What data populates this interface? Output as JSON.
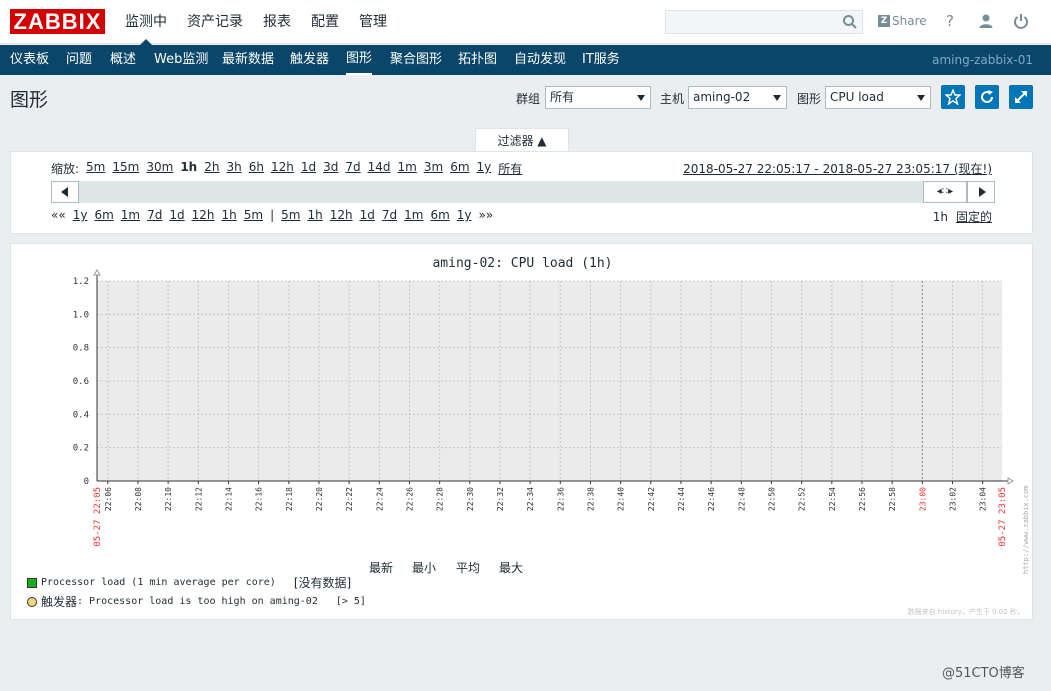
{
  "header": {
    "logo": "ZABBIX",
    "menu": [
      "监测中",
      "资产记录",
      "报表",
      "配置",
      "管理"
    ],
    "share_label": "Share",
    "help_label": "?"
  },
  "nav": {
    "items": [
      "仪表板",
      "问题",
      "概述",
      "Web监测",
      "最新数据",
      "触发器",
      "图形",
      "聚合图形",
      "拓扑图",
      "自动发现",
      "IT服务"
    ],
    "active": "图形",
    "server": "aming-zabbix-01"
  },
  "page": {
    "title": "图形",
    "group_label": "群组",
    "group_value": "所有",
    "host_label": "主机",
    "host_value": "aming-02",
    "graph_label": "图形",
    "graph_value": "CPU load"
  },
  "filter": {
    "tab_label": "过滤器 ▲",
    "zoom_label": "缩放:",
    "zoom_options": [
      "5m",
      "15m",
      "30m",
      "1h",
      "2h",
      "3h",
      "6h",
      "12h",
      "1d",
      "3d",
      "7d",
      "14d",
      "1m",
      "3m",
      "6m",
      "1y",
      "所有"
    ],
    "zoom_current": "1h",
    "period": "2018-05-27 22:05:17 - 2018-05-27 23:05:17 (现在!)",
    "back_links": [
      "1y",
      "6m",
      "1m",
      "7d",
      "1d",
      "12h",
      "1h",
      "5m"
    ],
    "fwd_links": [
      "5m",
      "1h",
      "12h",
      "1d",
      "7d",
      "1m",
      "6m",
      "1y"
    ],
    "period_len": "1h",
    "fixed_label": "固定的"
  },
  "graph": {
    "title": "aming-02: CPU load (1h)",
    "legend_headers": [
      "最新",
      "最小",
      "平均",
      "最大"
    ],
    "legend": [
      {
        "name": "Processor load (1 min average per core)",
        "status": "[没有数据]",
        "color": "#1aaf1a"
      },
      {
        "prefix": "触发器",
        "name": ": Processor load is too high on aming-02",
        "status": "[> 5]",
        "color": "#f7d57c"
      }
    ],
    "credit": "数据来自 history。产生于 0.02 秒。",
    "side_text": "http://www.zabbix.com"
  },
  "chart_data": {
    "type": "line",
    "title": "aming-02: CPU load (1h)",
    "ylim": [
      0,
      1.2
    ],
    "y_ticks": [
      "0",
      "0.2",
      "0.4",
      "0.6",
      "0.8",
      "1.0",
      "1.2"
    ],
    "x_start_label": "05-27 22:05",
    "x_end_label": "05-27 23:05",
    "x_ticks": [
      "22:06",
      "22:08",
      "22:10",
      "22:12",
      "22:14",
      "22:16",
      "22:18",
      "22:20",
      "22:22",
      "22:24",
      "22:26",
      "22:28",
      "22:30",
      "22:32",
      "22:34",
      "22:36",
      "22:38",
      "22:40",
      "22:42",
      "22:44",
      "22:46",
      "22:48",
      "22:50",
      "22:52",
      "22:54",
      "22:56",
      "22:58",
      "23:00",
      "23:02",
      "23:04"
    ],
    "highlight_tick": "23:00",
    "series": [
      {
        "name": "Processor load (1 min average per core)",
        "values": []
      }
    ],
    "grid": true
  },
  "watermark": "@51CTO博客"
}
